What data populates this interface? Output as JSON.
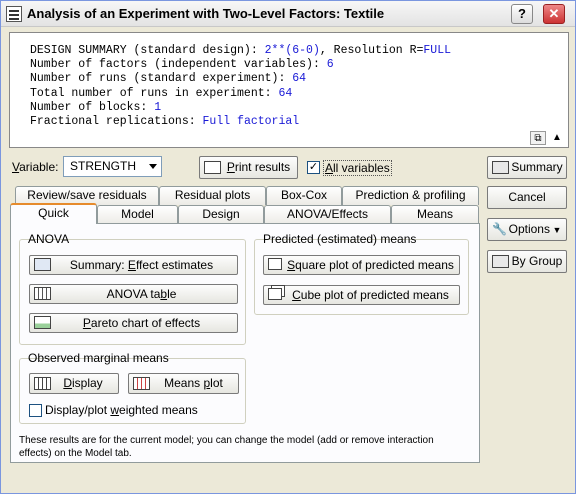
{
  "window": {
    "title": "Analysis of an Experiment with Two-Level Factors: Textile",
    "help_btn": "?",
    "close_btn": "✕"
  },
  "summary": {
    "l1_label": "DESIGN SUMMARY (standard design): ",
    "l1_value": "2**(6-0)",
    "l1_mid": ", Resolution R=",
    "l1_res": "FULL",
    "l2_label": "Number of factors (independent variables): ",
    "l2_value": "6",
    "l3_label": "Number of runs (standard experiment): ",
    "l3_value": "64",
    "l4_label": "Total number of runs in experiment: ",
    "l4_value": "64",
    "l5_label": "Number of blocks: ",
    "l5_value": "1",
    "l6_label": "Fractional replications: ",
    "l6_value": "Full factorial"
  },
  "variable": {
    "label_pre": "",
    "label_u": "V",
    "label_post": "ariable:",
    "value": "STRENGTH"
  },
  "print_results": {
    "pre": "",
    "u": "P",
    "post": "rint results"
  },
  "all_variables": {
    "checked": "✓",
    "pre": "",
    "u": "A",
    "post": "ll variables"
  },
  "right_buttons": {
    "summary": "Summary",
    "cancel": "Cancel",
    "options": "Options",
    "by_group": "By Group"
  },
  "tabs_back": [
    "Review/save residuals",
    "Residual plots",
    "Box-Cox",
    "Prediction & profiling"
  ],
  "tabs_front": [
    "Quick",
    "Model",
    "Design",
    "ANOVA/Effects",
    "Means"
  ],
  "anova": {
    "group_label": "ANOVA",
    "effect_estimates": {
      "pre": "Summary:  ",
      "u": "E",
      "post": "ffect estimates"
    },
    "anova_table": {
      "pre": "ANOVA ta",
      "u": "b",
      "post": "le"
    },
    "pareto": {
      "pre": "",
      "u": "P",
      "post": "areto chart of effects"
    }
  },
  "predicted": {
    "group_label": "Predicted (estimated) means",
    "square": {
      "pre": "",
      "u": "S",
      "post": "quare plot of predicted means"
    },
    "cube": {
      "pre": "",
      "u": "C",
      "post": "ube plot of predicted means"
    }
  },
  "observed": {
    "group_label": "Observed marginal means",
    "display": {
      "pre": "",
      "u": "D",
      "post": "isplay"
    },
    "means_plot": {
      "pre": "Means ",
      "u": "p",
      "post": "lot"
    },
    "weighted": {
      "pre": "Display/plot ",
      "u": "w",
      "post": "eighted means"
    }
  },
  "note": "These results are for the current model; you can change the model (add or remove interaction effects) on the Model tab."
}
